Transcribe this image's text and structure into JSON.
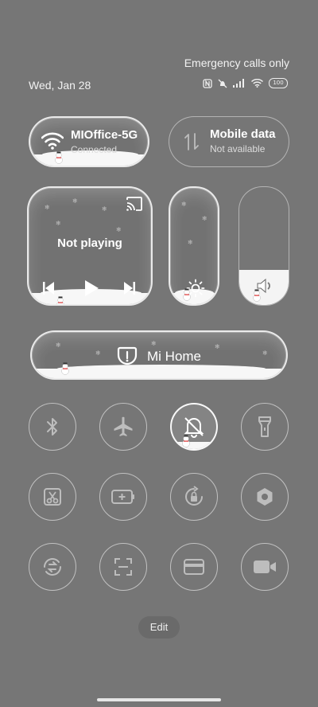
{
  "status": {
    "emergency": "Emergency calls only",
    "date": "Wed, Jan 28",
    "battery": "100"
  },
  "wifi": {
    "title": "MIOffice-5G",
    "subtitle": "Connected"
  },
  "mobile": {
    "title": "Mobile data",
    "subtitle": "Not available"
  },
  "media": {
    "status": "Not playing"
  },
  "mi_home": {
    "label": "Mi Home"
  },
  "edit": {
    "label": "Edit"
  },
  "toggles": [
    {
      "name": "bluetooth",
      "active": false
    },
    {
      "name": "airplane-mode",
      "active": false
    },
    {
      "name": "silent-mode",
      "active": true
    },
    {
      "name": "flashlight",
      "active": false
    },
    {
      "name": "screenshot",
      "active": false
    },
    {
      "name": "battery-saver",
      "active": false
    },
    {
      "name": "rotation-lock",
      "active": false
    },
    {
      "name": "settings",
      "active": false
    },
    {
      "name": "sync",
      "active": false
    },
    {
      "name": "scanner",
      "active": false
    },
    {
      "name": "cards",
      "active": false
    },
    {
      "name": "screen-recorder",
      "active": false
    }
  ]
}
